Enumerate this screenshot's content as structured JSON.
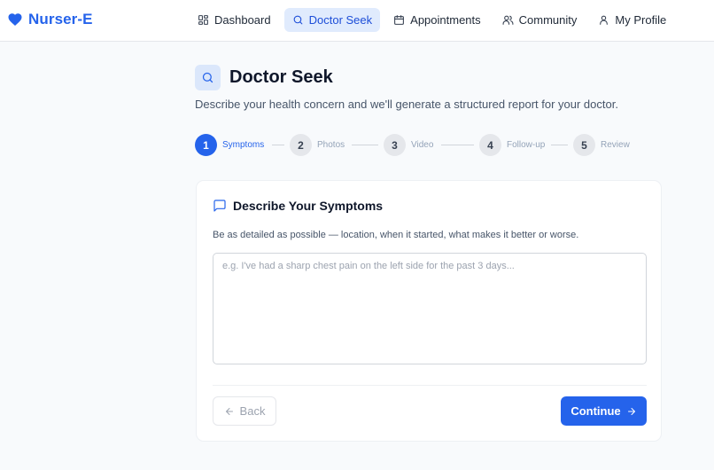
{
  "brand": {
    "name": "Nurser-E",
    "icon": "heart-icon",
    "color": "#2563eb"
  },
  "nav": {
    "items": [
      {
        "label": "Dashboard",
        "icon": "dashboard-grid-icon",
        "active": false
      },
      {
        "label": "Doctor Seek",
        "icon": "search-icon",
        "active": true
      },
      {
        "label": "Appointments",
        "icon": "calendar-icon",
        "active": false
      },
      {
        "label": "Community",
        "icon": "users-icon",
        "active": false
      },
      {
        "label": "My Profile",
        "icon": "user-icon",
        "active": false
      }
    ]
  },
  "page": {
    "title": "Doctor Seek",
    "title_icon": "search-icon",
    "subtitle": "Describe your health concern and we'll generate a structured report for your doctor."
  },
  "stepper": {
    "current_step": 1,
    "steps": [
      {
        "number": "1",
        "label": "Symptoms"
      },
      {
        "number": "2",
        "label": "Photos"
      },
      {
        "number": "3",
        "label": "Video"
      },
      {
        "number": "4",
        "label": "Follow-up"
      },
      {
        "number": "5",
        "label": "Review"
      }
    ]
  },
  "card": {
    "icon": "message-square-icon",
    "title": "Describe Your Symptoms",
    "hint": "Be as detailed as possible — location, when it started, what makes it better or worse.",
    "input": {
      "value": "",
      "placeholder": "e.g. I've had a sharp chest pain on the left side for the past 3 days..."
    },
    "back_label": "Back",
    "continue_label": "Continue"
  },
  "colors": {
    "accent": "#2563eb",
    "accent_soft": "#e0ebfd",
    "page_bg": "#f8fafc"
  }
}
